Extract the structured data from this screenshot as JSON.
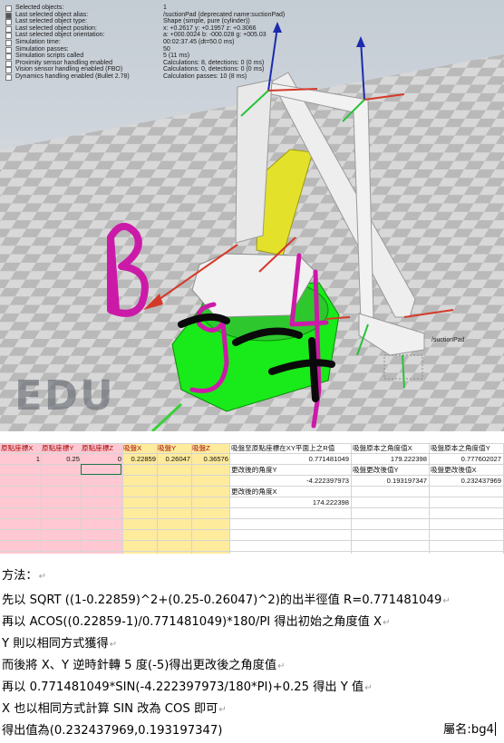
{
  "sim": {
    "info": [
      {
        "label": "Selected objects:",
        "value": "1",
        "checked": false
      },
      {
        "label": "Last selected object alias:",
        "value": "/suctionPad    (deprecated name:suctionPad)",
        "checked": true
      },
      {
        "label": "Last selected object type:",
        "value": "Shape (simple, pure (cylinder))",
        "checked": false
      },
      {
        "label": "Last selected object position:",
        "value": "x: +0.2617    y: +0.1957    z: +0.3066",
        "checked": false
      },
      {
        "label": "Last selected object orientation:",
        "value": "a: +000.0024    b: -000.028    g: +005.03",
        "checked": false
      },
      {
        "label": "Simulation time:",
        "value": "00:02:37.45 (dt=50.0 ms)",
        "checked": false
      },
      {
        "label": "Simulation passes:",
        "value": "50",
        "checked": false
      },
      {
        "label": "Simulation scripts called",
        "value": "5 (11 ms)",
        "checked": false
      },
      {
        "label": "Proximity sensor handling enabled",
        "value": "Calculations: 8, detections: 0 (0 ms)",
        "checked": false
      },
      {
        "label": "Vision sensor handling enabled (FBO)",
        "value": "Calculations: 0, detections: 0 (0 ms)",
        "checked": false
      },
      {
        "label": "Dynamics handling enabled (Bullet 2.78)",
        "value": "Calculation passes: 10 (8 ms)",
        "checked": false
      }
    ],
    "watermark": "EDU",
    "object_label": "/suctionPad"
  },
  "sheet": {
    "headers": [
      "原點座標X",
      "原點座標Y",
      "原點座標Z",
      "吸盤X",
      "吸盤Y",
      "吸盤Z"
    ],
    "origin": [
      "1",
      "0.25",
      "0"
    ],
    "pad": [
      "0.22859",
      "0.26047",
      "0.36576"
    ],
    "calc": [
      {
        "label": "吸盤至原點座標在XY平面上之R值",
        "value": "0.771481049"
      },
      {
        "label": "更改後的角度Y",
        "value": "-4.222397973"
      },
      {
        "label": "更改後的角度X",
        "value": "174.222398"
      }
    ],
    "angle": {
      "label": "吸盤原本之角度值X",
      "value": "179.222398"
    },
    "angle2": {
      "label": "吸盤原本之角度值Y",
      "value": "0.777602027"
    },
    "newy": {
      "label": "吸盤更改後值Y",
      "value": "0.193197347"
    },
    "newx": {
      "label": "吸盤更改後值X",
      "value": "0.232437969"
    }
  },
  "doc": {
    "lines": [
      "方法：",
      "先以 SQRT ((1-0.22859)^2+(0.25-0.26047)^2)的出半徑值 R=0.771481049",
      "再以 ACOS((0.22859-1)/0.771481049)*180/PI 得出初始之角度值 X",
      "Y 則以相同方式獲得",
      "而後將 X、Y 逆時針轉 5 度(-5)得出更改後之角度值",
      "再以 0.771481049*SIN(-4.222397973/180*PI)+0.25 得出 Y 值",
      "X 也以相同方式計算 SIN 改為 COS 即可",
      "得出值為(0.232437969,0.193197347)"
    ],
    "signature": "屬名:bg4",
    "handwriting": "Bg4"
  },
  "colors": {
    "pink": "#ffc8d2",
    "yellow": "#ffeb9c",
    "selected_cell_border": "#217346",
    "base_green": "#19ea19",
    "handwriting_magenta": "#cc1aa8"
  }
}
